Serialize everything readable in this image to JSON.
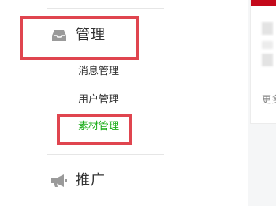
{
  "sidebar": {
    "manage": {
      "label": "管理",
      "icon": "inbox-icon",
      "items": [
        {
          "label": "消息管理"
        },
        {
          "label": "用户管理"
        },
        {
          "label": "素材管理",
          "active": true
        }
      ]
    },
    "promote": {
      "label": "推广",
      "icon": "megaphone-icon"
    }
  },
  "right_panel": {
    "more_label": "更多"
  },
  "colors": {
    "active": "#1aad19",
    "highlight": "#e0454f",
    "brand_bar": "#c4081a"
  }
}
